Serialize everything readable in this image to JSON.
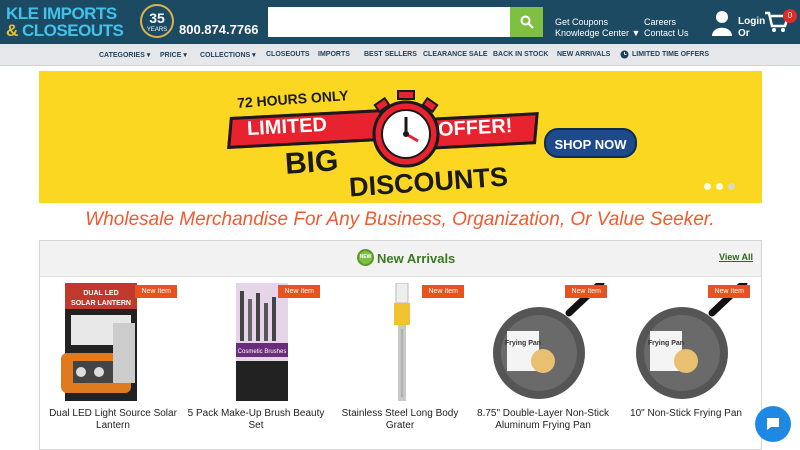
{
  "header": {
    "logo_line1": "K",
    "logo_line1b": "LE IMPORTS",
    "logo_amp": "&",
    "logo_line2": " CLOSEOUTS",
    "badge_number": "35",
    "badge_label": "YEARS",
    "phone": "800.874.7766",
    "search_placeholder": "",
    "links": {
      "coupons": "Get Coupons",
      "knowledge": "Knowledge Center ▼",
      "careers": "Careers",
      "contact": "Contact Us"
    },
    "login": "Login",
    "login_sub": "Or",
    "cart_count": "0"
  },
  "nav": {
    "items": [
      "CATEGORIES ▾",
      "PRICE ▾",
      "COLLECTIONS ▾",
      "CLOSEOUTS",
      "IMPORTS",
      "BEST SELLERS",
      "CLEARANCE SALE",
      "BACK IN STOCK",
      "NEW ARRIVALS",
      "LIMITED TIME OFFERS"
    ]
  },
  "banner": {
    "hours": "72 HOURS ONLY",
    "limited": "LIMITED",
    "offer": "OFFER!",
    "big": "BIG",
    "discounts": "DISCOUNTS",
    "cta": "SHOP NOW"
  },
  "tagline": "Wholesale Merchandise For Any Business, Organization, Or Value Seeker.",
  "arrivals": {
    "title": "New Arrivals",
    "view_all": "View All",
    "products": [
      {
        "name": "Dual LED Light Source Solar Lantern",
        "tag": "New Item",
        "art_text": "DUAL LED SOLAR LANTERN"
      },
      {
        "name": "5 Pack Make-Up Brush Beauty Set",
        "tag": "New Item",
        "art_text": "Cosmetic Brushes"
      },
      {
        "name": "Stainless Steel Long Body Grater",
        "tag": "New Item",
        "art_text": ""
      },
      {
        "name": "8.75\" Double-Layer Non-Stick Aluminum Frying Pan",
        "tag": "New Item",
        "art_text": "Frying Pan"
      },
      {
        "name": "10\" Non-Stick Frying Pan",
        "tag": "New Item",
        "art_text": "Frying Pan"
      }
    ]
  },
  "colors": {
    "header": "#1d4a63",
    "accent_green": "#7fbf41",
    "banner_yellow": "#fbd722",
    "tag_orange": "#e8521e",
    "tagline": "#ee5b2f"
  }
}
